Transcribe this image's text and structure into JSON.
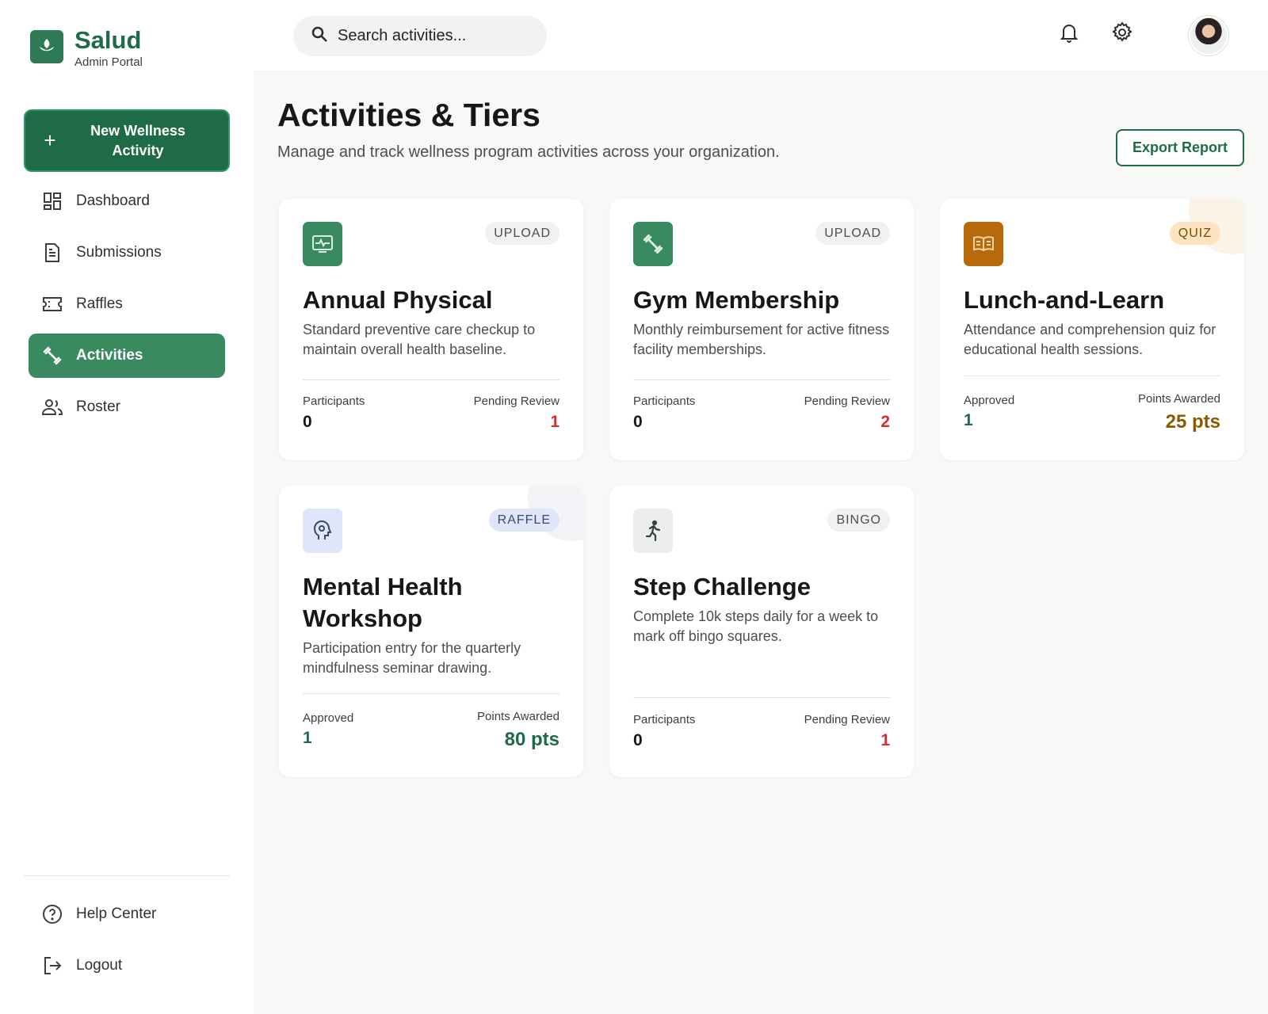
{
  "app": {
    "name": "Salud",
    "subtitle": "Admin Portal"
  },
  "sidebar": {
    "new_button": {
      "line1": "New Wellness",
      "line2": "Activity"
    },
    "items": [
      {
        "label": "Dashboard",
        "icon": "dashboard-icon"
      },
      {
        "label": "Submissions",
        "icon": "document-icon"
      },
      {
        "label": "Raffles",
        "icon": "ticket-icon"
      },
      {
        "label": "Activities",
        "icon": "dumbbell-icon",
        "active": true
      },
      {
        "label": "Roster",
        "icon": "people-icon"
      }
    ],
    "bottom": [
      {
        "label": "Help Center",
        "icon": "help-icon"
      },
      {
        "label": "Logout",
        "icon": "logout-icon"
      }
    ]
  },
  "topbar": {
    "search_placeholder": "Search activities..."
  },
  "page": {
    "title": "Activities & Tiers",
    "subtitle": "Manage and track wellness program activities across your organization.",
    "export_label": "Export Report"
  },
  "colors": {
    "primary": "#1f6b46",
    "active_nav": "#3a8a60",
    "pending": "#d92d2d",
    "gold": "#8a5a00"
  },
  "cards": [
    {
      "title": "Annual Physical",
      "badge": "UPLOAD",
      "description": "Standard preventive care checkup to maintain overall health baseline.",
      "stat1_label": "Participants",
      "stat1_value": "0",
      "stat2_label": "Pending Review",
      "stat2_value": "1"
    },
    {
      "title": "Gym Membership",
      "badge": "UPLOAD",
      "description": "Monthly reimbursement for active fitness facility memberships.",
      "stat1_label": "Participants",
      "stat1_value": "0",
      "stat2_label": "Pending Review",
      "stat2_value": "2"
    },
    {
      "title": "Lunch-and-Learn",
      "badge": "QUIZ",
      "description": "Attendance and comprehension quiz for educational health sessions.",
      "stat1_label": "Approved",
      "stat1_value": "1",
      "stat2_label": "Points Awarded",
      "stat2_value": "25 pts"
    },
    {
      "title": "Mental Health Workshop",
      "badge": "RAFFLE",
      "description": "Participation entry for the quarterly mindfulness seminar drawing.",
      "stat1_label": "Approved",
      "stat1_value": "1",
      "stat2_label": "Points Awarded",
      "stat2_value": "80 pts"
    },
    {
      "title": "Step Challenge",
      "badge": "BINGO",
      "description": "Complete 10k steps daily for a week to mark off bingo squares.",
      "stat1_label": "Participants",
      "stat1_value": "0",
      "stat2_label": "Pending Review",
      "stat2_value": "1"
    }
  ]
}
